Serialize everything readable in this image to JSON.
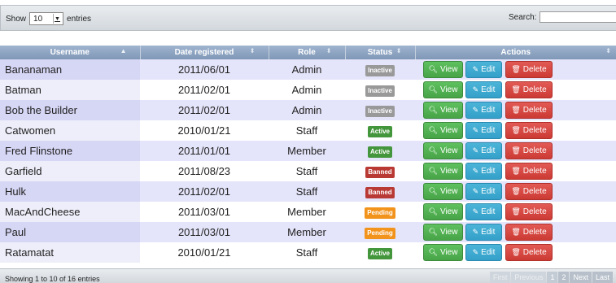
{
  "controls": {
    "show_label": "Show",
    "length_value": "10",
    "entries_label": "entries",
    "search_label": "Search:",
    "search_value": ""
  },
  "table": {
    "columns": [
      "Username",
      "Date registered",
      "Role",
      "Status",
      "Actions"
    ],
    "rows": [
      {
        "username": "Bananaman",
        "date": "2011/06/01",
        "role": "Admin",
        "status": "Inactive"
      },
      {
        "username": "Batman",
        "date": "2011/02/01",
        "role": "Admin",
        "status": "Inactive"
      },
      {
        "username": "Bob the Builder",
        "date": "2011/02/01",
        "role": "Admin",
        "status": "Inactive"
      },
      {
        "username": "Catwomen",
        "date": "2010/01/21",
        "role": "Staff",
        "status": "Active"
      },
      {
        "username": "Fred Flinstone",
        "date": "2011/01/01",
        "role": "Member",
        "status": "Active"
      },
      {
        "username": "Garfield",
        "date": "2011/08/23",
        "role": "Staff",
        "status": "Banned"
      },
      {
        "username": "Hulk",
        "date": "2011/02/01",
        "role": "Staff",
        "status": "Banned"
      },
      {
        "username": "MacAndCheese",
        "date": "2011/03/01",
        "role": "Member",
        "status": "Pending"
      },
      {
        "username": "Paul",
        "date": "2011/03/01",
        "role": "Member",
        "status": "Pending"
      },
      {
        "username": "Ratamatat",
        "date": "2010/01/21",
        "role": "Staff",
        "status": "Active"
      }
    ],
    "actions": {
      "view": "View",
      "edit": "Edit",
      "delete": "Delete"
    },
    "icons": {
      "view": "zoom-in-icon",
      "edit": "edit-icon",
      "delete": "trash-icon",
      "sort": "sort-arrows-icon",
      "sort_asc": "sort-ascending-icon"
    }
  },
  "footer": {
    "info": "Showing 1 to 10 of 16 entries",
    "pagination": [
      "First",
      "Previous",
      "1",
      "2",
      "Next",
      "Last"
    ]
  },
  "colors": {
    "header": "#8fa6c3",
    "row_odd": "#e4e4fa",
    "view": "#47a447",
    "edit": "#34a0c9",
    "delete": "#cc3a34",
    "inactive": "#999999",
    "active": "#44963c",
    "banned": "#b93a34",
    "pending": "#f2931c"
  }
}
